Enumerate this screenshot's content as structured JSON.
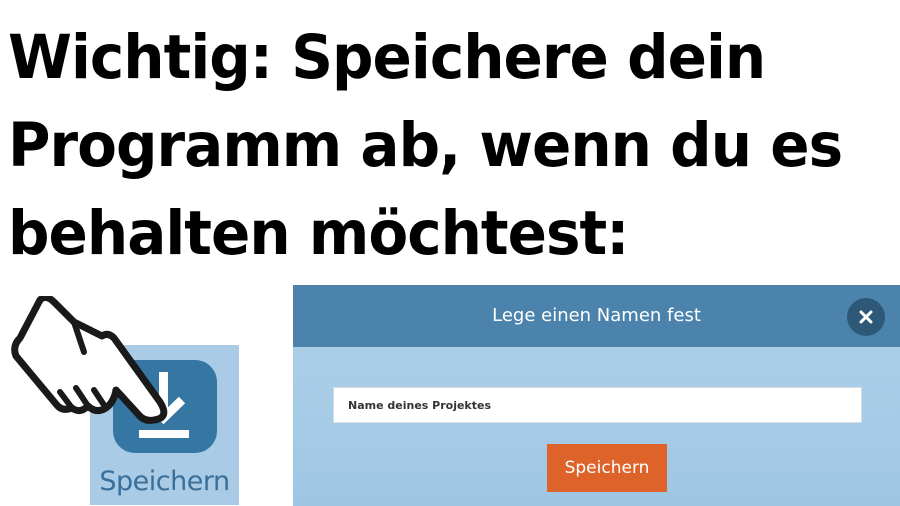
{
  "headline": {
    "lines": [
      "Wichtig: Speichere dein",
      "Programm ab, wenn du es",
      "behalten möchtest:"
    ]
  },
  "save_tile": {
    "label": "Speichern",
    "icon": "download-icon"
  },
  "cursor": {
    "icon": "pointing-hand-icon"
  },
  "dialog": {
    "title": "Lege einen Namen fest",
    "close_icon": "close-icon",
    "input_placeholder": "Name deines Projektes",
    "input_value": "",
    "save_label": "Speichern"
  },
  "colors": {
    "tile_background": "#a9cbe6",
    "icon_background": "#3576a3",
    "dialog_header": "#4c83ad",
    "dialog_body": "#a6cbe6",
    "close_button": "#2d5878",
    "save_button": "#dd632b"
  }
}
